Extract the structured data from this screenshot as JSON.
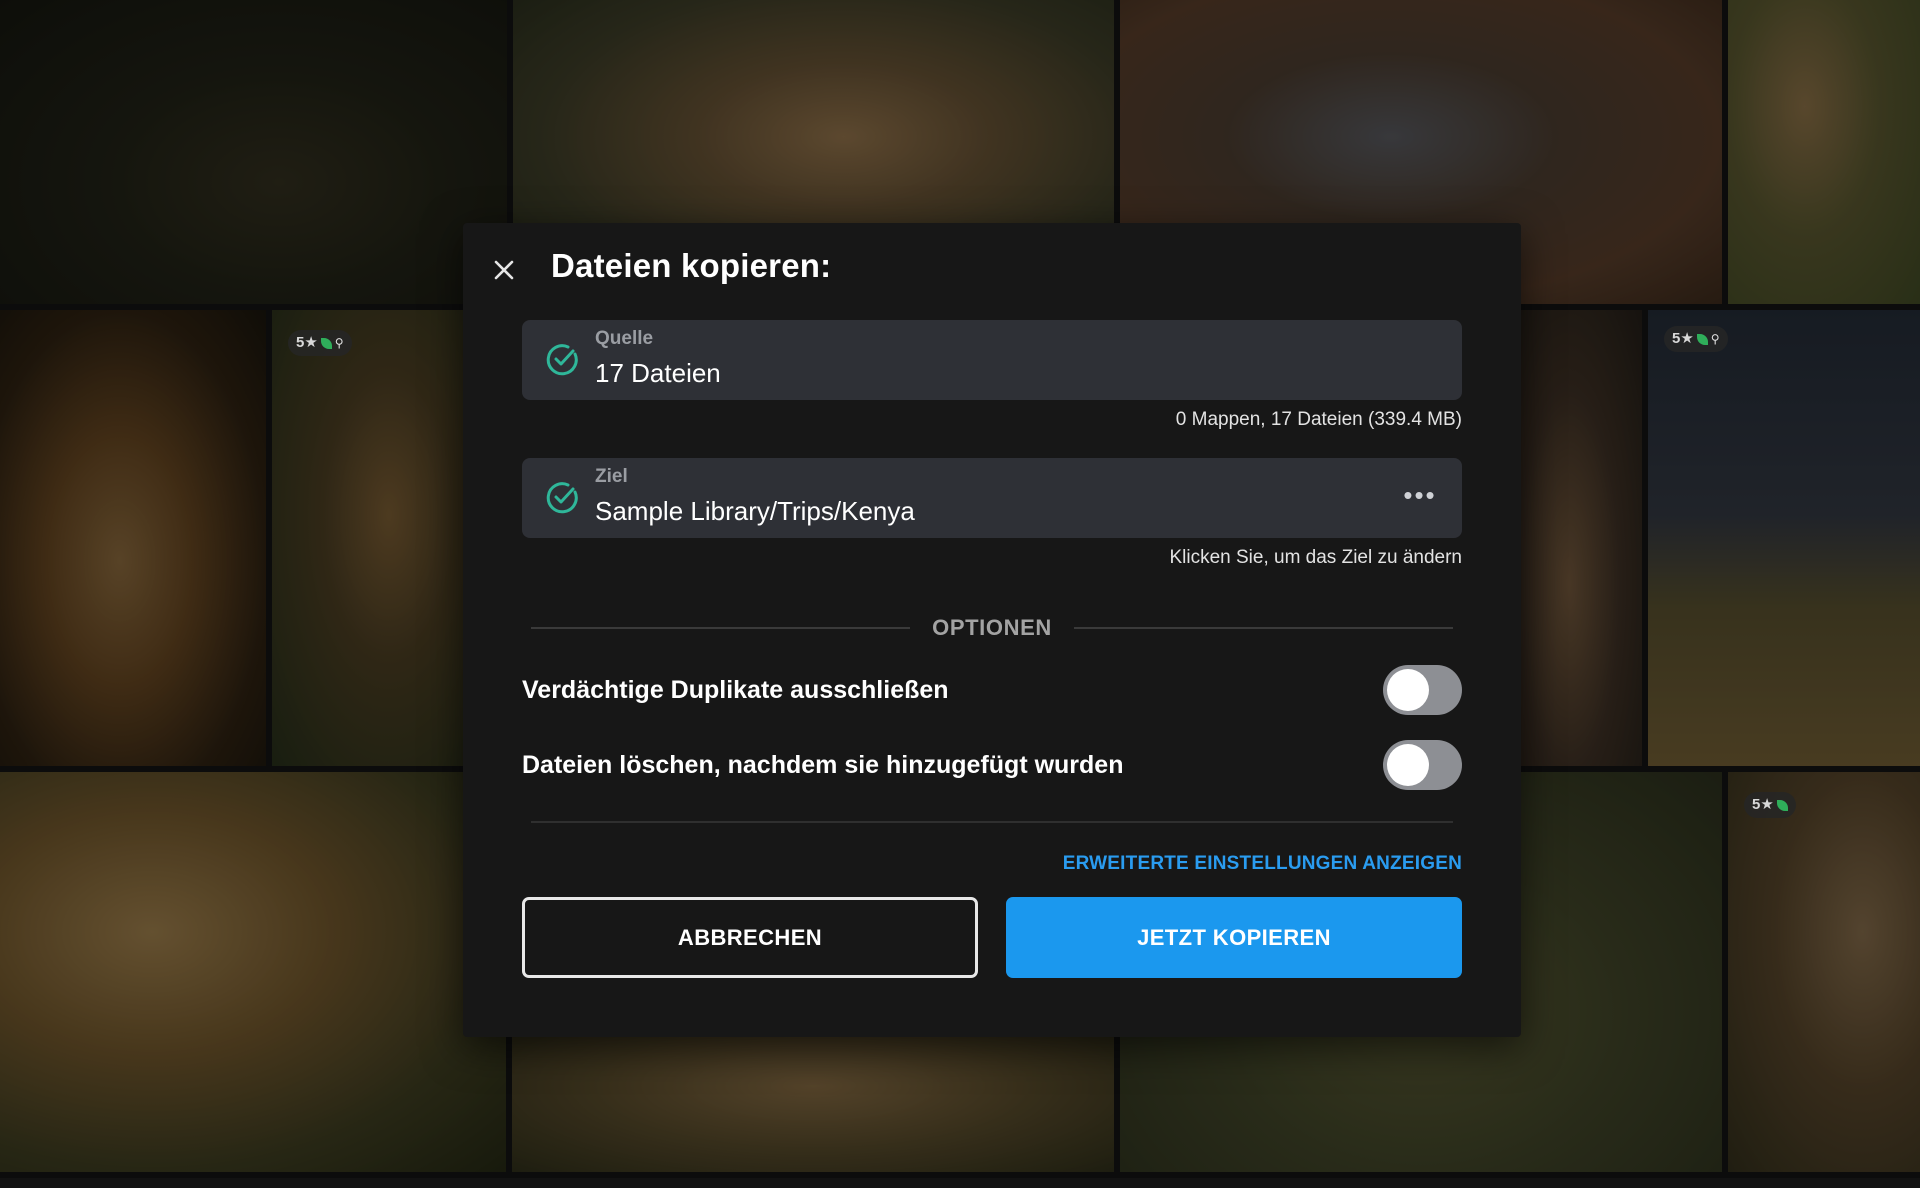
{
  "background_badges": {
    "tile_a": "5★",
    "tile_b": "5★",
    "tile_c": "5★"
  },
  "dialog": {
    "title": "Dateien kopieren:",
    "close_icon": "close-icon",
    "source": {
      "caption": "Quelle",
      "value": "17 Dateien",
      "summary": "0 Mappen, 17 Dateien (339.4 MB)"
    },
    "target": {
      "caption": "Ziel",
      "value": "Sample Library/Trips/Kenya",
      "more": "•••",
      "hint": "Klicken Sie, um das Ziel zu ändern"
    },
    "options_heading": "OPTIONEN",
    "options": [
      {
        "label": "Verdächtige Duplikate ausschließen",
        "enabled": false
      },
      {
        "label": "Dateien löschen, nachdem sie hinzugefügt wurden",
        "enabled": false
      }
    ],
    "advanced_link": "ERWEITERTE EINSTELLUNGEN ANZEIGEN",
    "cancel_label": "ABBRECHEN",
    "copy_label": "JETZT KOPIEREN"
  },
  "colors": {
    "accent": "#1b98ee",
    "link": "#2a9cf0",
    "check": "#2fb79a",
    "modal_bg": "#171717",
    "field_bg": "#2e3036"
  }
}
